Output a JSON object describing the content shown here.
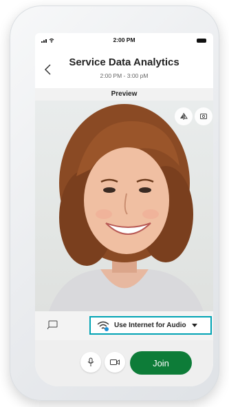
{
  "status": {
    "time": "2:00 PM"
  },
  "meeting": {
    "title": "Service Data Analytics",
    "time_range": "2:00 PM - 3:00 pM"
  },
  "preview": {
    "label": "Preview"
  },
  "audio": {
    "option_label": "Use Internet for Audio"
  },
  "actions": {
    "join_label": "Join"
  },
  "icons": {
    "back": "chevron-left-icon",
    "signal": "signal-icon",
    "wifi": "wifi-icon",
    "battery": "battery-icon",
    "mirror": "mirror-icon",
    "switch_camera": "switch-camera-icon",
    "cast": "cast-icon",
    "internet_audio": "wifi-audio-icon",
    "dropdown": "caret-down-icon",
    "microphone": "microphone-icon",
    "video": "video-camera-icon"
  },
  "colors": {
    "join": "#0d7c38",
    "audio_border": "#00a3b4",
    "audio_icon_dot": "#1a8fd6"
  }
}
